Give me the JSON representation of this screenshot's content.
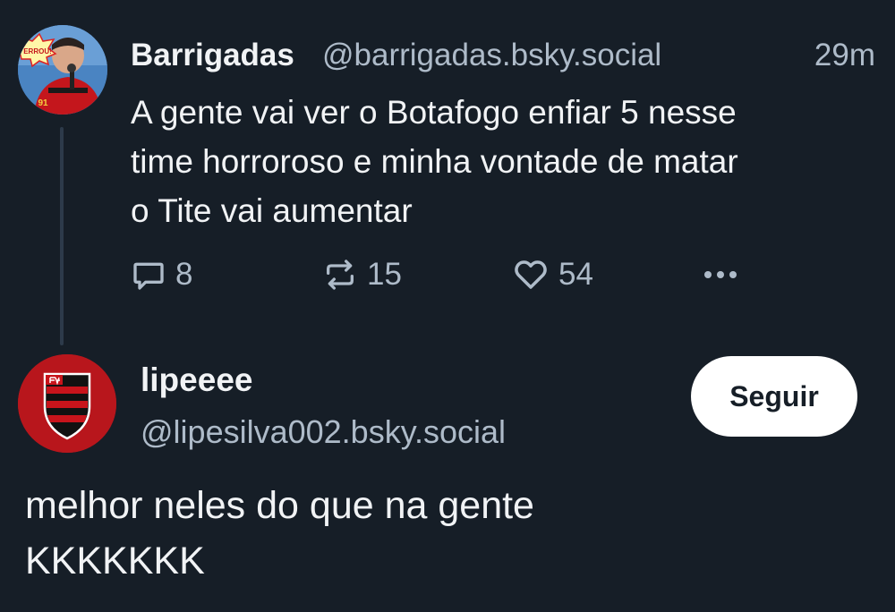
{
  "parent_post": {
    "author_name": "Barrigadas",
    "author_handle": "@barrigadas.bsky.social",
    "time": "29m",
    "text_lines": [
      "A gente vai ver o Botafogo enfiar 5 nesse",
      "time horroroso e minha vontade de matar",
      "o Tite vai aumentar"
    ],
    "avatar": {
      "badge_text": "ERROU!",
      "shirt_number": "91"
    },
    "actions": {
      "reply_icon": "speech-bubble-icon",
      "reply_count": "8",
      "repost_icon": "repost-arrows-icon",
      "repost_count": "15",
      "like_icon": "heart-icon",
      "like_count": "54",
      "more_icon": "ellipsis-icon"
    }
  },
  "reply_post": {
    "author_name": "lipeeee",
    "author_handle": "@lipesilva002.bsky.social",
    "follow_label": "Seguir",
    "text_lines": [
      "melhor neles do que na gente",
      "KKKKKKK"
    ]
  },
  "colors": {
    "background": "#161e27",
    "text_primary": "#f1f3f5",
    "text_secondary": "#aebbc9",
    "thread_line": "#2d3a4a",
    "follow_button_bg": "#ffffff",
    "flamengo_red": "#c8141b",
    "flamengo_black": "#111111"
  }
}
